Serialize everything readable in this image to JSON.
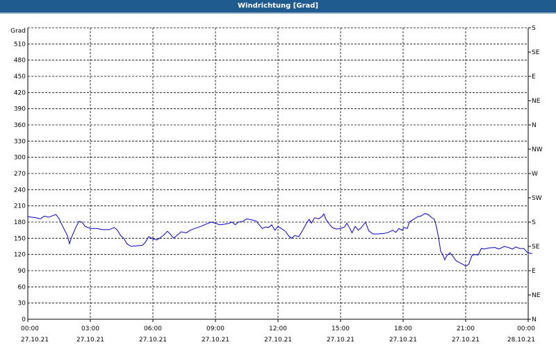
{
  "window": {
    "title": "Windrichtung [Grad]"
  },
  "chart_data": {
    "type": "line",
    "title": "Windrichtung [Grad]",
    "ylabel": "Grad",
    "xlabel": "",
    "xlim_hours": [
      0,
      24
    ],
    "ylim": [
      0,
      540
    ],
    "grid": true,
    "yticks": [
      0,
      30,
      60,
      90,
      120,
      150,
      180,
      210,
      240,
      270,
      300,
      330,
      360,
      390,
      420,
      450,
      480,
      510
    ],
    "right_labels": [
      {
        "value": 0,
        "label": "N"
      },
      {
        "value": 45,
        "label": "NE"
      },
      {
        "value": 90,
        "label": "E"
      },
      {
        "value": 135,
        "label": "SE"
      },
      {
        "value": 180,
        "label": "S"
      },
      {
        "value": 225,
        "label": "SW"
      },
      {
        "value": 270,
        "label": "W"
      },
      {
        "value": 315,
        "label": "NW"
      },
      {
        "value": 360,
        "label": "N"
      },
      {
        "value": 405,
        "label": "NE"
      },
      {
        "value": 450,
        "label": "E"
      },
      {
        "value": 495,
        "label": "SE"
      },
      {
        "value": 540,
        "label": "S"
      }
    ],
    "xticks": [
      {
        "hour": 0,
        "time": "00:00",
        "date": "27.10.21"
      },
      {
        "hour": 3,
        "time": "03:00",
        "date": "27.10.21"
      },
      {
        "hour": 6,
        "time": "06:00",
        "date": "27.10.21"
      },
      {
        "hour": 9,
        "time": "09:00",
        "date": "27.10.21"
      },
      {
        "hour": 12,
        "time": "12:00",
        "date": "27.10.21"
      },
      {
        "hour": 15,
        "time": "15:00",
        "date": "27.10.21"
      },
      {
        "hour": 18,
        "time": "18:00",
        "date": "27.10.21"
      },
      {
        "hour": 21,
        "time": "21:00",
        "date": "27.10.21"
      },
      {
        "hour": 24,
        "time": "00:00",
        "date": "28.10.21"
      }
    ],
    "series": [
      {
        "color": "#0000cc",
        "points": [
          [
            0.0,
            190
          ],
          [
            0.4,
            188
          ],
          [
            0.6,
            186
          ],
          [
            0.8,
            191
          ],
          [
            1.0,
            189
          ],
          [
            1.2,
            192
          ],
          [
            1.35,
            194
          ],
          [
            1.5,
            186
          ],
          [
            1.7,
            170
          ],
          [
            1.9,
            155
          ],
          [
            2.0,
            140
          ],
          [
            2.1,
            152
          ],
          [
            2.3,
            170
          ],
          [
            2.45,
            181
          ],
          [
            2.6,
            180
          ],
          [
            2.75,
            172
          ],
          [
            3.0,
            168
          ],
          [
            3.3,
            168
          ],
          [
            3.6,
            166
          ],
          [
            3.9,
            166
          ],
          [
            4.15,
            170
          ],
          [
            4.3,
            165
          ],
          [
            4.45,
            155
          ],
          [
            4.6,
            150
          ],
          [
            4.75,
            140
          ],
          [
            4.95,
            135
          ],
          [
            5.2,
            136
          ],
          [
            5.5,
            137
          ],
          [
            5.65,
            143
          ],
          [
            5.8,
            153
          ],
          [
            6.0,
            149
          ],
          [
            6.2,
            147
          ],
          [
            6.5,
            155
          ],
          [
            6.7,
            163
          ],
          [
            6.85,
            157
          ],
          [
            7.0,
            150
          ],
          [
            7.15,
            155
          ],
          [
            7.35,
            162
          ],
          [
            7.6,
            160
          ],
          [
            7.8,
            165
          ],
          [
            8.0,
            168
          ],
          [
            8.3,
            172
          ],
          [
            8.6,
            177
          ],
          [
            8.8,
            180
          ],
          [
            9.0,
            178
          ],
          [
            9.2,
            175
          ],
          [
            9.4,
            176
          ],
          [
            9.6,
            177
          ],
          [
            9.8,
            180
          ],
          [
            9.95,
            175
          ],
          [
            10.1,
            180
          ],
          [
            10.3,
            181
          ],
          [
            10.5,
            186
          ],
          [
            10.75,
            184
          ],
          [
            10.95,
            182
          ],
          [
            11.1,
            175
          ],
          [
            11.25,
            168
          ],
          [
            11.4,
            171
          ],
          [
            11.55,
            170
          ],
          [
            11.7,
            175
          ],
          [
            11.85,
            165
          ],
          [
            12.0,
            172
          ],
          [
            12.2,
            167
          ],
          [
            12.35,
            163
          ],
          [
            12.5,
            155
          ],
          [
            12.65,
            150
          ],
          [
            12.8,
            155
          ],
          [
            13.0,
            153
          ],
          [
            13.2,
            166
          ],
          [
            13.4,
            180
          ],
          [
            13.5,
            185
          ],
          [
            13.6,
            178
          ],
          [
            13.75,
            188
          ],
          [
            13.95,
            186
          ],
          [
            14.1,
            190
          ],
          [
            14.2,
            195
          ],
          [
            14.3,
            185
          ],
          [
            14.45,
            177
          ],
          [
            14.6,
            170
          ],
          [
            14.8,
            167
          ],
          [
            15.0,
            168
          ],
          [
            15.2,
            171
          ],
          [
            15.3,
            178
          ],
          [
            15.45,
            168
          ],
          [
            15.55,
            160
          ],
          [
            15.7,
            172
          ],
          [
            15.85,
            165
          ],
          [
            16.0,
            170
          ],
          [
            16.2,
            180
          ],
          [
            16.35,
            164
          ],
          [
            16.55,
            158
          ],
          [
            16.8,
            158
          ],
          [
            17.1,
            159
          ],
          [
            17.3,
            161
          ],
          [
            17.5,
            165
          ],
          [
            17.65,
            161
          ],
          [
            17.8,
            168
          ],
          [
            17.95,
            165
          ],
          [
            18.05,
            170
          ],
          [
            18.2,
            168
          ],
          [
            18.3,
            180
          ],
          [
            18.5,
            185
          ],
          [
            18.7,
            190
          ],
          [
            18.85,
            191
          ],
          [
            19.05,
            196
          ],
          [
            19.2,
            194
          ],
          [
            19.35,
            189
          ],
          [
            19.5,
            185
          ],
          [
            19.6,
            171
          ],
          [
            19.7,
            152
          ],
          [
            19.8,
            126
          ],
          [
            19.9,
            120
          ],
          [
            20.0,
            110
          ],
          [
            20.1,
            118
          ],
          [
            20.25,
            123
          ],
          [
            20.4,
            116
          ],
          [
            20.55,
            108
          ],
          [
            20.75,
            104
          ],
          [
            20.9,
            101
          ],
          [
            21.0,
            98
          ],
          [
            21.15,
            102
          ],
          [
            21.3,
            118
          ],
          [
            21.45,
            120
          ],
          [
            21.6,
            119
          ],
          [
            21.75,
            131
          ],
          [
            21.9,
            130
          ],
          [
            22.1,
            132
          ],
          [
            22.4,
            133
          ],
          [
            22.6,
            130
          ],
          [
            22.85,
            135
          ],
          [
            23.05,
            133
          ],
          [
            23.25,
            130
          ],
          [
            23.4,
            134
          ],
          [
            23.6,
            131
          ],
          [
            23.8,
            131
          ],
          [
            23.95,
            124
          ],
          [
            24.1,
            122
          ],
          [
            24.2,
            122
          ]
        ]
      }
    ]
  }
}
